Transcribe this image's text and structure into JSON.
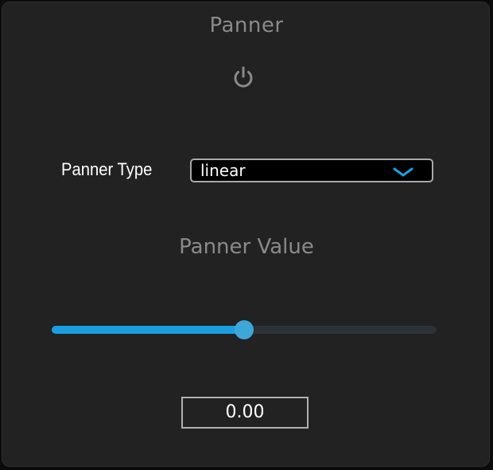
{
  "panel": {
    "title": "Panner",
    "power_icon": "power-icon"
  },
  "panner_type": {
    "label": "Panner Type",
    "selected": "linear",
    "chevron_icon": "chevron-down-icon",
    "chevron_color": "#1a9fe0"
  },
  "panner_value": {
    "label": "Panner Value",
    "fraction": 0.5,
    "display": "0.00",
    "accent_color": "#1a9fe0"
  }
}
